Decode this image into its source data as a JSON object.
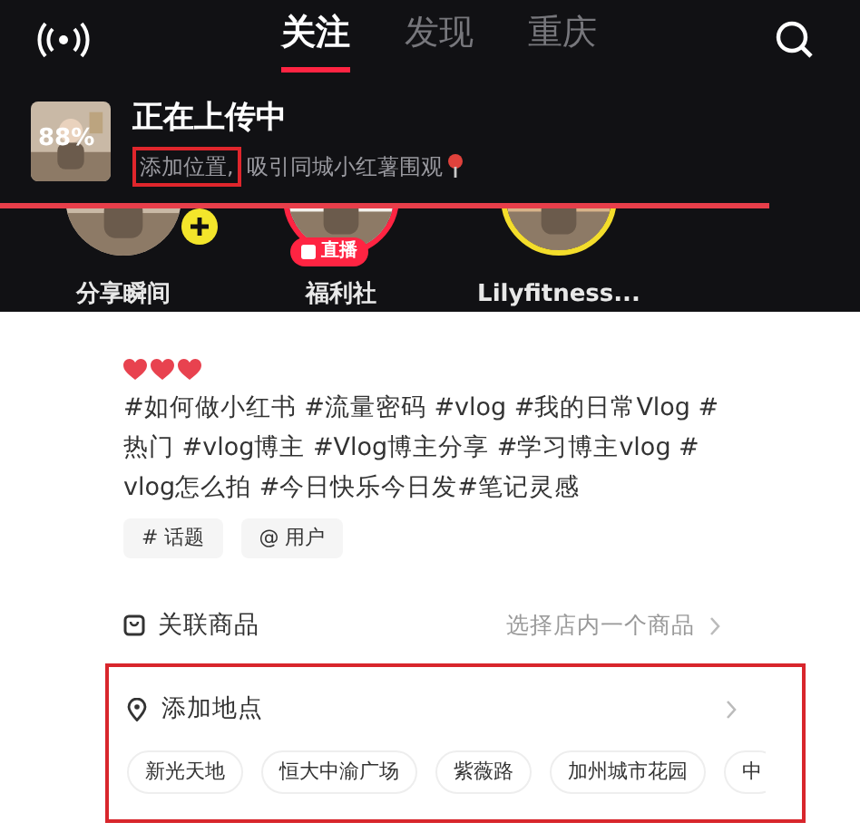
{
  "header": {
    "tabs": [
      {
        "label": "关注",
        "selected": true
      },
      {
        "label": "发现",
        "selected": false
      },
      {
        "label": "重庆",
        "selected": false
      }
    ]
  },
  "upload": {
    "title": "正在上传中",
    "progress": "88%",
    "location_prompt": "添加位置,",
    "prompt_highlighted": true,
    "hint": "吸引同城小红薯围观"
  },
  "stories": [
    {
      "name": "分享瞬间",
      "kind": "add"
    },
    {
      "name": "福利社",
      "kind": "live",
      "badge": "直播"
    },
    {
      "name": "Lilyfitness...",
      "kind": "ring"
    }
  ],
  "note": {
    "text_lines": [
      "#如何做小红书 #流量密码 #vlog #我的日常Vlog #",
      "热门 #vlog博主 #Vlog博主分享 #学习博主vlog #",
      "vlog怎么拍 #今日快乐今日发#笔记灵感"
    ],
    "tag_buttons": [
      "# 话题",
      "@ 用户"
    ]
  },
  "product": {
    "label": "关联商品",
    "hint": "选择店内一个商品"
  },
  "location": {
    "label": "添加地点",
    "highlighted": true,
    "suggestions": [
      "新光天地",
      "恒大中渝广场",
      "紫薇路",
      "加州城市花园",
      "中"
    ]
  }
}
